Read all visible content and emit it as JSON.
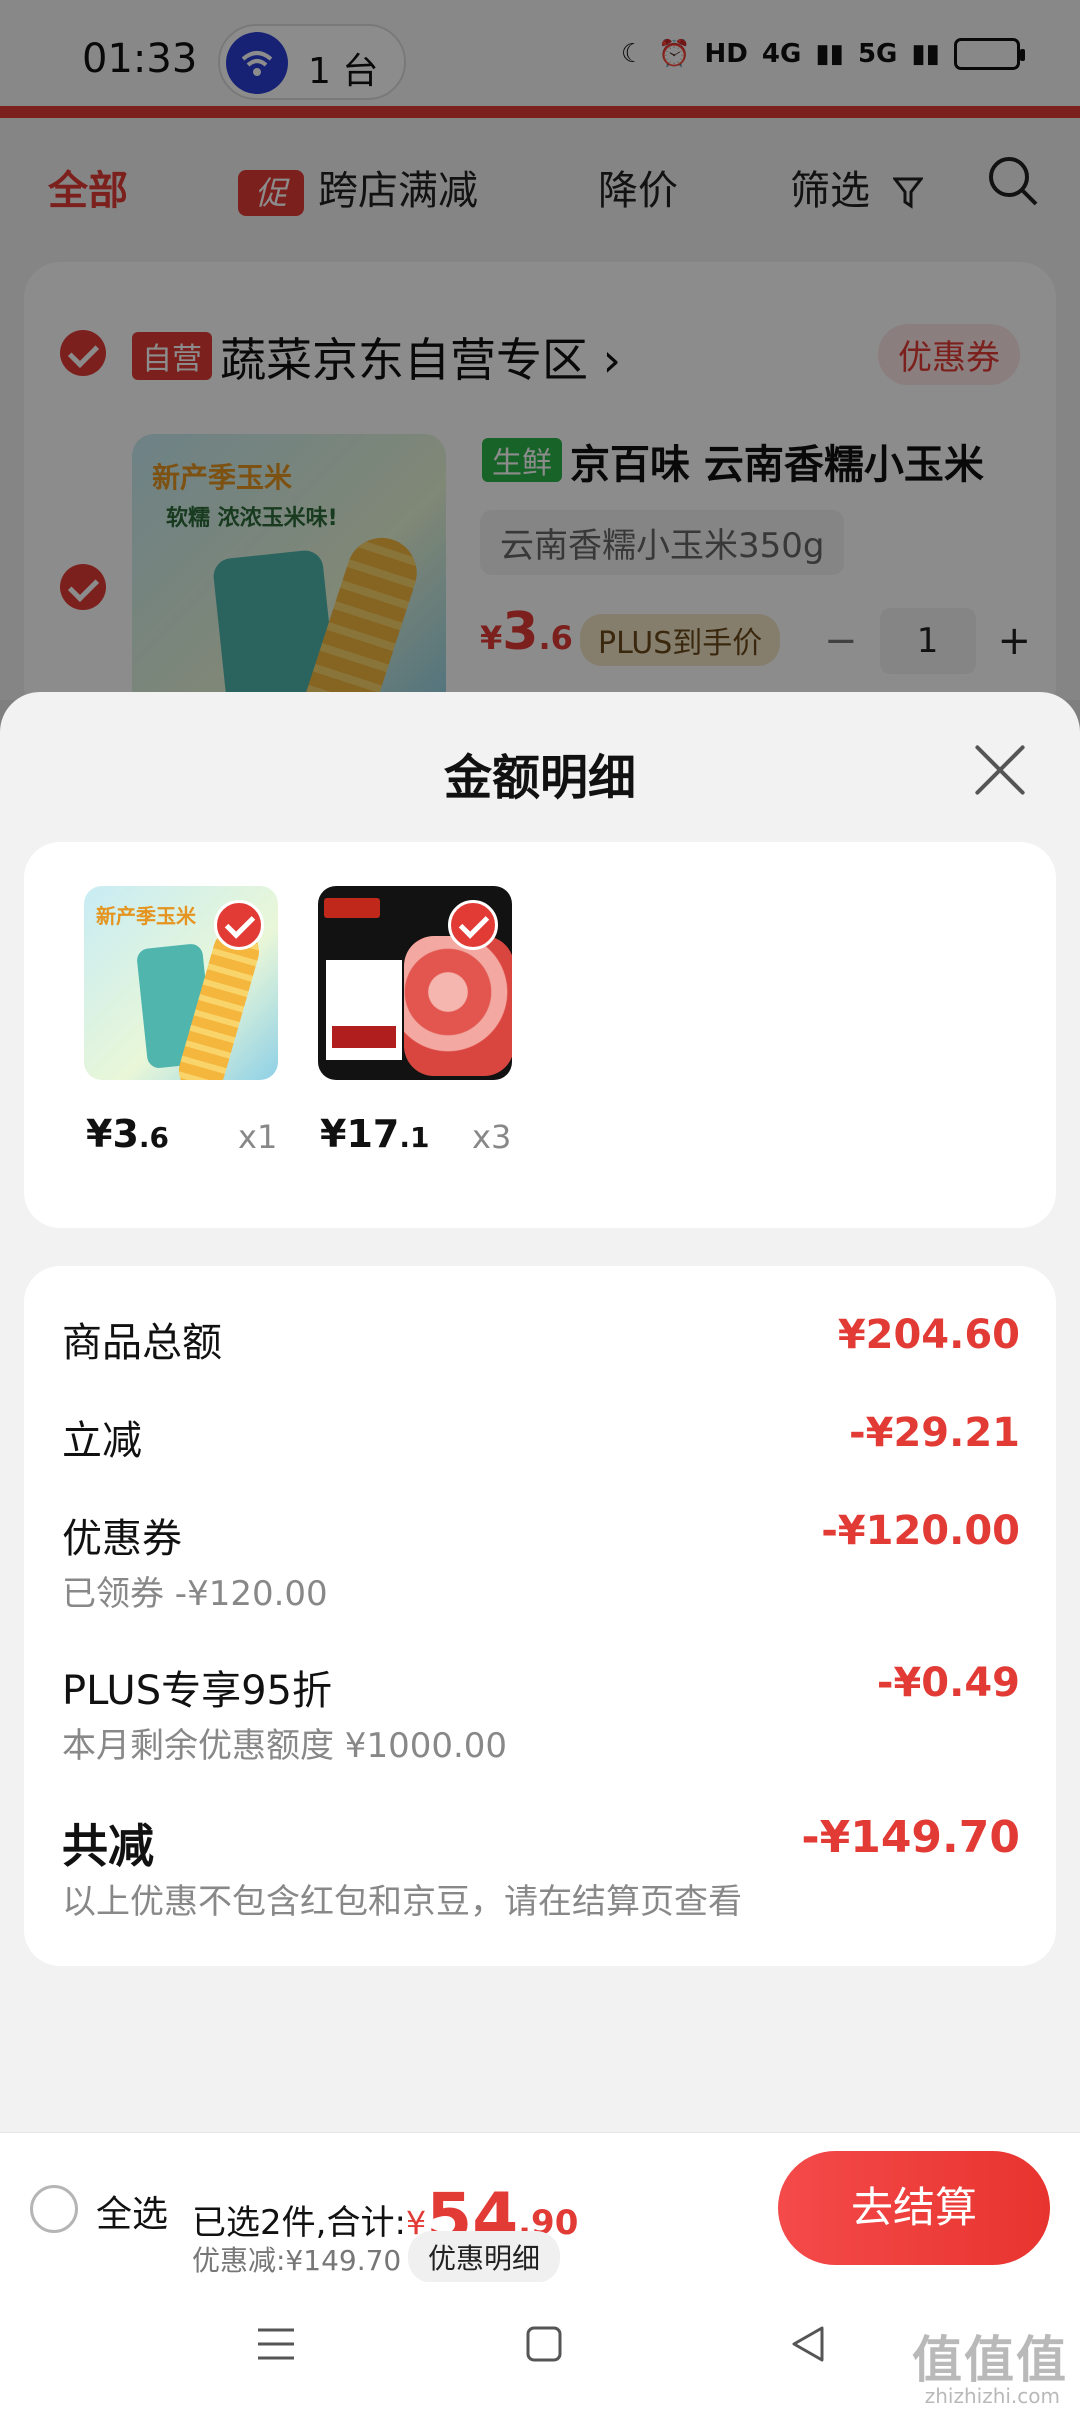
{
  "status_bar": {
    "time": "01:33",
    "hotspot_count": "1 台",
    "network_labels": [
      "HD",
      "4G",
      "5G"
    ]
  },
  "filters": [
    {
      "label": "全部",
      "active": true
    },
    {
      "label": "跨店满减",
      "tag": "促"
    },
    {
      "label": "降价"
    },
    {
      "label": "筛选"
    }
  ],
  "store": {
    "tag": "自营",
    "name": "蔬菜京东自营专区",
    "chevron": "›",
    "coupon": "优惠券",
    "product": {
      "image_text_1": "新产季玉米",
      "image_text_2": "软糯 浓浓玉米味!",
      "fresh_tag": "生鲜",
      "title": "京百味 云南香糯小玉米",
      "spec": "云南香糯小玉米350g",
      "price_currency": "¥",
      "price_int": "3",
      "price_dec": ".6",
      "plus_label": "PLUS到手价",
      "minus": "−",
      "qty": "1",
      "plus": "+"
    }
  },
  "sheet": {
    "title": "金额明细",
    "items": [
      {
        "price_int": "¥3",
        "price_dec": ".6",
        "qty": "x1",
        "image_text": "新产季玉米"
      },
      {
        "price_int": "¥17",
        "price_dec": ".1",
        "qty": "x3"
      }
    ],
    "rows": [
      {
        "label": "商品总额",
        "value": "¥204.60"
      },
      {
        "label": "立减",
        "value": "-¥29.21"
      },
      {
        "label": "优惠券",
        "sub": "已领券 -¥120.00",
        "value": "-¥120.00"
      },
      {
        "label": "PLUS专享95折",
        "sub": "本月剩余优惠额度 ¥1000.00",
        "value": "-¥0.49"
      },
      {
        "label": "共减",
        "sub": "以上优惠不包含红包和京豆，请在结算页查看",
        "value": "-¥149.70"
      }
    ]
  },
  "bottom": {
    "select_all": "全选",
    "selected_prefix": "已选2件,合计:",
    "currency": "¥",
    "total_int": "54",
    "total_dec": ".90",
    "discount": "优惠减:¥149.70",
    "detail_btn": "优惠明细",
    "checkout": "去结算"
  },
  "watermark": {
    "text": "值值值",
    "url": "zhizhizhi.com"
  },
  "colors": {
    "accent": "#e23b35",
    "fresh": "#2db54a",
    "primary_button": "#f0403c"
  }
}
